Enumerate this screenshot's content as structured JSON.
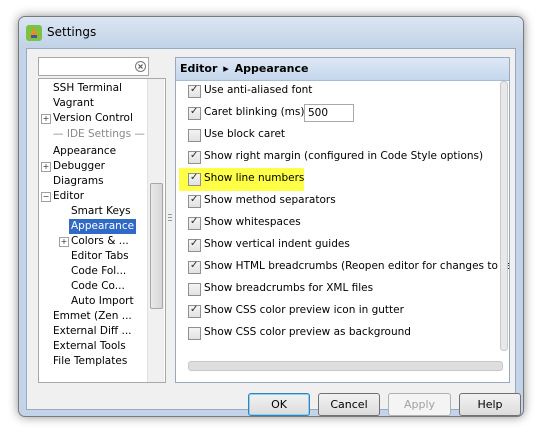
{
  "window": {
    "title": "Settings"
  },
  "search": {
    "placeholder": "",
    "value": ""
  },
  "tree": {
    "items": [
      {
        "label": "SSH Terminal"
      },
      {
        "label": "Vagrant"
      },
      {
        "label": "Version Control"
      },
      {
        "label": "IDE Settings"
      },
      {
        "label": "Appearance"
      },
      {
        "label": "Debugger"
      },
      {
        "label": "Diagrams"
      },
      {
        "label": "Editor"
      },
      {
        "label": "Smart Keys"
      },
      {
        "label": "Appearance"
      },
      {
        "label": "Colors & ..."
      },
      {
        "label": "Editor Tabs"
      },
      {
        "label": "Code Fol..."
      },
      {
        "label": "Code Co..."
      },
      {
        "label": "Auto Import"
      },
      {
        "label": "Emmet (Zen ..."
      },
      {
        "label": "External Diff ..."
      },
      {
        "label": "External Tools"
      },
      {
        "label": "File Templates"
      }
    ]
  },
  "panel": {
    "breadcrumb_parent": "Editor",
    "breadcrumb_separator": "▸",
    "breadcrumb_current": "Appearance"
  },
  "options": [
    {
      "label": "Use anti-aliased font",
      "checked": true
    },
    {
      "label": "Caret blinking (ms):",
      "checked": true,
      "value": "500"
    },
    {
      "label": "Use block caret",
      "checked": false
    },
    {
      "label": "Show right margin (configured in Code Style options)",
      "checked": true
    },
    {
      "label": "Show line numbers",
      "checked": true,
      "highlight_color": "#ffff47"
    },
    {
      "label": "Show method separators",
      "checked": true
    },
    {
      "label": "Show whitespaces",
      "checked": true
    },
    {
      "label": "Show vertical indent guides",
      "checked": true
    },
    {
      "label": "Show HTML breadcrumbs (Reopen editor for changes to take effect)",
      "checked": true
    },
    {
      "label": "Show breadcrumbs for XML files",
      "checked": false
    },
    {
      "label": "Show CSS color preview icon in gutter",
      "checked": true
    },
    {
      "label": "Show CSS color preview as background",
      "checked": false
    }
  ],
  "buttons": {
    "ok": "OK",
    "cancel": "Cancel",
    "apply": "Apply",
    "help": "Help"
  },
  "colors": {
    "selection": "#3169c6",
    "highlight": "#ffff47",
    "header": "#c5d7ec"
  }
}
